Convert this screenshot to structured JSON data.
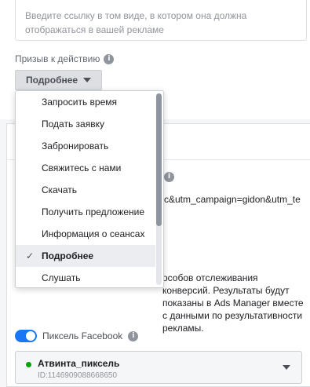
{
  "website_url": {
    "placeholder": "Введите ссылку в том виде, в котором она должна отображаться в вашей рекламе"
  },
  "call_to_action": {
    "label": "Призыв к действию",
    "selected": "Подробнее",
    "options": [
      {
        "label": "Запросить время",
        "selected": false
      },
      {
        "label": "Подать заявку",
        "selected": false
      },
      {
        "label": "Забронировать",
        "selected": false
      },
      {
        "label": "Свяжитесь с нами",
        "selected": false
      },
      {
        "label": "Скачать",
        "selected": false
      },
      {
        "label": "Получить предложение",
        "selected": false
      },
      {
        "label": "Информация о сеансах",
        "selected": false
      },
      {
        "label": "Подробнее",
        "selected": true
      },
      {
        "label": "Слушать",
        "selected": false
      }
    ]
  },
  "url_parameters": {
    "value": "c&utm_campaign=gidon&utm_te"
  },
  "tracking": {
    "description": "особов отслеживания конверсий. Результаты будут показаны в Ads Manager вместе с данными по результативности рекламы."
  },
  "pixel": {
    "toggle_label": "Пиксель Facebook",
    "toggle_on": true,
    "name": "Атвинта_пиксель",
    "id": "ID:1146909088668650",
    "status_color": "#00a400"
  },
  "colors": {
    "accent": "#1877f2"
  }
}
